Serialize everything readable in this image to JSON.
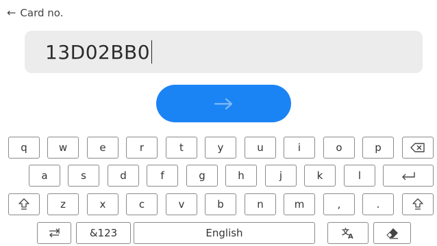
{
  "header": {
    "back_glyph": "←",
    "title": "Card no."
  },
  "input": {
    "value": "13D02BB0"
  },
  "submit": {
    "arrow_glyph": "→",
    "color": "#1b84f4"
  },
  "keyboard": {
    "row1": [
      "q",
      "w",
      "e",
      "r",
      "t",
      "y",
      "u",
      "i",
      "o",
      "p"
    ],
    "row2": [
      "a",
      "s",
      "d",
      "f",
      "g",
      "h",
      "j",
      "k",
      "l"
    ],
    "row3": [
      "z",
      "x",
      "c",
      "v",
      "b",
      "n",
      "m",
      ",",
      "."
    ],
    "symbols_label": "&123",
    "space_label": "English",
    "icons": {
      "backspace": "backspace-icon",
      "enter": "enter-icon",
      "shift": "shift-icon",
      "switch": "switch-arrows-icon",
      "translate": "translate-icon",
      "eraser": "eraser-icon"
    }
  }
}
